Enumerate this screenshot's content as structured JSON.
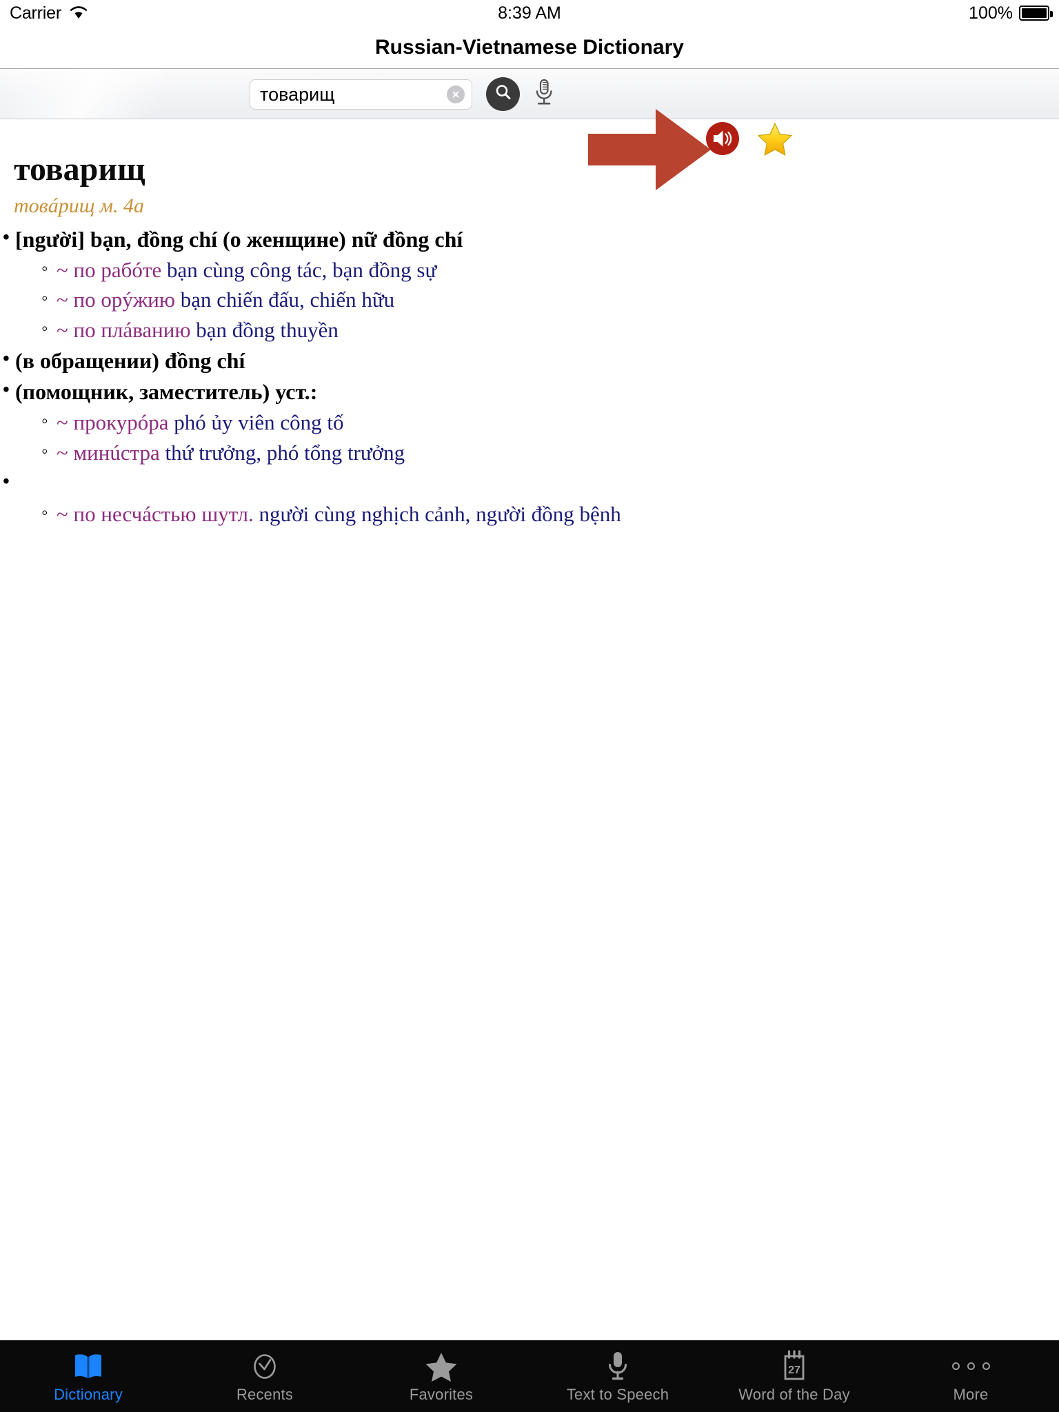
{
  "status_bar": {
    "carrier": "Carrier",
    "wifi_icon": "wifi-icon",
    "time": "8:39 AM",
    "battery_percent": "100%",
    "battery_icon": "battery-full-icon"
  },
  "nav": {
    "title": "Russian-Vietnamese Dictionary"
  },
  "search": {
    "value": "товарищ",
    "placeholder": "",
    "clear_icon": "clear-circle-icon",
    "search_icon": "search-icon",
    "mic_icon": "microphone-icon"
  },
  "annotations": {
    "arrow_icon": "right-arrow-annotation",
    "arrow_color": "#b8432e"
  },
  "article_actions": {
    "speak_icon": "speaker-icon",
    "speak_color": "#b21f12",
    "favorite_icon": "star-icon",
    "favorite_color": "#ffd21e"
  },
  "article": {
    "headword": "товарищ",
    "transcription": "товáрищ м. 4а",
    "colors": {
      "headword": "#0d0d0d",
      "transcription": "#c79035",
      "russian_example": "#8e2b7d",
      "vietnamese": "#1b1b78"
    },
    "senses": [
      {
        "definition": "[người] bạn, đồng chí (о женщине) nữ đồng chí",
        "examples": [
          {
            "tilde": "~",
            "ru": "по рабóте",
            "vi": "bạn cùng công tác, bạn đồng sự"
          },
          {
            "tilde": "~",
            "ru": "по орýжию",
            "vi": "bạn chiến đấu, chiến hữu"
          },
          {
            "tilde": "~",
            "ru": "по плáванию",
            "vi": "bạn đồng thuyền"
          }
        ]
      },
      {
        "definition": "(в обращении) đồng chí",
        "examples": []
      },
      {
        "definition": "(помощник, заместитель) уст.:",
        "examples": [
          {
            "tilde": "~",
            "ru": "прокурóра",
            "vi": "phó ủy viên công tố"
          },
          {
            "tilde": "~",
            "ru": "минúстра",
            "vi": "thứ trưởng, phó tổng trưởng"
          }
        ]
      },
      {
        "definition": "",
        "examples": [
          {
            "tilde": "~",
            "ru": "по несчáстью шутл.",
            "vi": "người cùng nghịch cảnh, người đồng bệnh"
          }
        ]
      }
    ]
  },
  "tabbar": {
    "items": [
      {
        "label": "Dictionary",
        "icon": "book-icon",
        "active": true
      },
      {
        "label": "Recents",
        "icon": "clock-check-icon",
        "active": false
      },
      {
        "label": "Favorites",
        "icon": "star-icon",
        "active": false
      },
      {
        "label": "Text to Speech",
        "icon": "microphone-icon",
        "active": false
      },
      {
        "label": "Word of the Day",
        "icon": "calendar-27-icon",
        "active": false
      },
      {
        "label": "More",
        "icon": "ellipsis-icon",
        "active": false
      }
    ],
    "calendar_day": "27",
    "active_color": "#1a84ff",
    "inactive_color": "#9b9b9b"
  }
}
